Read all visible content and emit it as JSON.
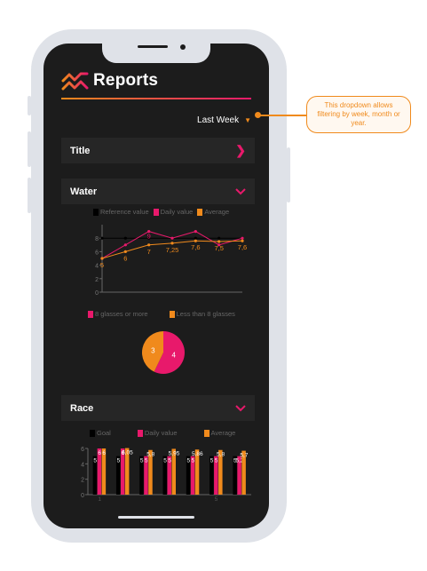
{
  "app": {
    "title": "Reports"
  },
  "filter": {
    "value": "Last Week"
  },
  "annotation": {
    "text": "This dropdown allows filtering by week, month or year."
  },
  "sections": {
    "title": "Title",
    "water": "Water",
    "race": "Race"
  },
  "colors": {
    "accent_pink": "#e8196b",
    "accent_orange": "#f08a1c",
    "background": "#1c1c1c",
    "card": "#262626"
  },
  "icons": {
    "logo": "chart-trend-logo-icon",
    "expand": "chevron-right-icon",
    "collapse": "chevron-down-icon",
    "dropdown": "caret-down-icon"
  },
  "chart_data": [
    {
      "type": "line",
      "title": "",
      "legend": [
        "Reference value",
        "Daily value",
        "Average"
      ],
      "x": [
        1,
        2,
        3,
        4,
        5,
        6,
        7
      ],
      "series": [
        {
          "name": "Reference value",
          "color": "#000000",
          "values": [
            8,
            8,
            8,
            8,
            8,
            8,
            8
          ]
        },
        {
          "name": "Daily value",
          "color": "#e8196b",
          "values": [
            5,
            7,
            9,
            8,
            9,
            7,
            8
          ]
        },
        {
          "name": "Average",
          "color": "#f08a1c",
          "values": [
            5,
            6,
            7,
            7.25,
            7.6,
            7.5,
            7.6
          ]
        }
      ],
      "point_labels": [
        "5",
        "6",
        "7",
        "7,25",
        "7,6",
        "7,5",
        "7,6"
      ],
      "daily_label": "9",
      "yticks": [
        0,
        2,
        4,
        6,
        8
      ],
      "ylim": [
        0,
        10
      ]
    },
    {
      "type": "pie",
      "legend": [
        "8 glasses or more",
        "Less than 8 glasses"
      ],
      "slices": [
        {
          "name": "8 glasses or more",
          "value": 4,
          "color": "#e8196b"
        },
        {
          "name": "Less than 8 glasses",
          "value": 3,
          "color": "#f08a1c"
        }
      ]
    },
    {
      "type": "bar",
      "legend": [
        "Goal",
        "Daily value",
        "Average"
      ],
      "categories": [
        "1",
        "2",
        "3",
        "4",
        "5",
        "6",
        "7"
      ],
      "xtick_labels": [
        "1",
        "",
        "",
        "",
        "",
        "5",
        ""
      ],
      "series": [
        {
          "name": "Goal",
          "color": "#000000",
          "values": [
            5,
            5,
            5,
            5,
            5,
            5,
            5
          ]
        },
        {
          "name": "Daily value",
          "color": "#e8196b",
          "values": [
            6,
            6,
            5,
            5,
            5,
            5,
            5
          ]
        },
        {
          "name": "Average",
          "color": "#f08a1c",
          "values": [
            6,
            6.05,
            5.8,
            5.95,
            5.86,
            5.8,
            5.7
          ]
        }
      ],
      "bar_labels": [
        [
          "5",
          "6",
          "6"
        ],
        [
          "5",
          "6",
          "6,05"
        ],
        [
          "5",
          "5",
          "5,8"
        ],
        [
          "5",
          "5",
          "5,95"
        ],
        [
          "5",
          "5",
          "5,86"
        ],
        [
          "5",
          "5",
          "5,8"
        ],
        [
          "5",
          "5,2",
          "5,7"
        ]
      ],
      "yticks": [
        0,
        2,
        4,
        6
      ],
      "ylim": [
        0,
        6
      ]
    }
  ]
}
